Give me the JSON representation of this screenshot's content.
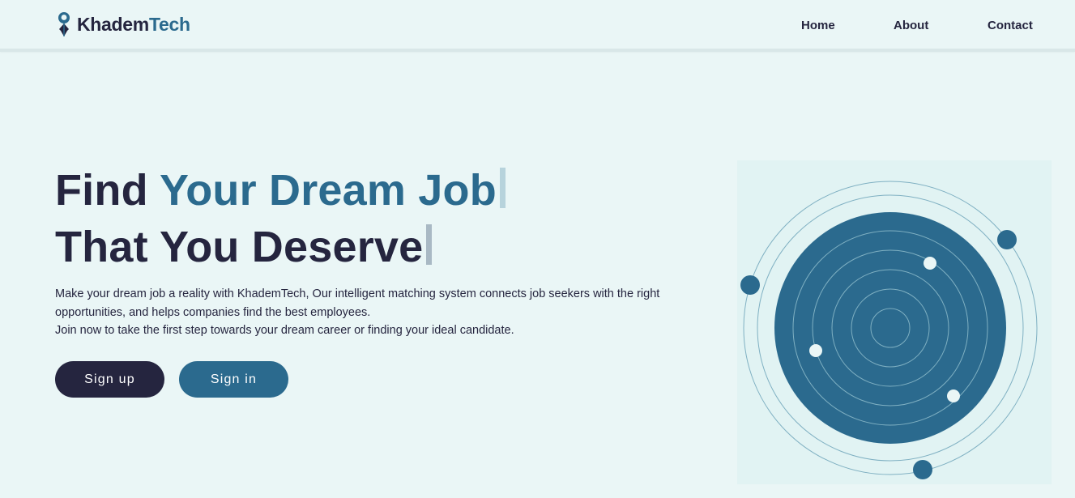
{
  "brand": {
    "name_part1": "Khadem",
    "name_part2": "Tech",
    "logo_icon": "person-pin-icon"
  },
  "nav": {
    "items": [
      {
        "label": "Home"
      },
      {
        "label": "About"
      },
      {
        "label": "Contact"
      }
    ]
  },
  "hero": {
    "title_line1_plain": "Find",
    "title_line1_accent": "Your Dream Job",
    "title_line2": "That You Deserve",
    "description_line1": "Make your dream job a reality with KhademTech, Our intelligent matching system connects job seekers with the right opportunities, and helps companies find the best employees.",
    "description_line2": "Join now to take the first step towards your dream career or finding your ideal candidate.",
    "signup_label": "Sign up",
    "signin_label": "Sign in"
  },
  "colors": {
    "background": "#eaf6f6",
    "dark": "#25253f",
    "accent": "#2b6a8e",
    "illustration_bg": "#e1f3f3",
    "orbit_line": "#7fb0c2"
  },
  "illustration": {
    "name": "orbit-illustration"
  }
}
